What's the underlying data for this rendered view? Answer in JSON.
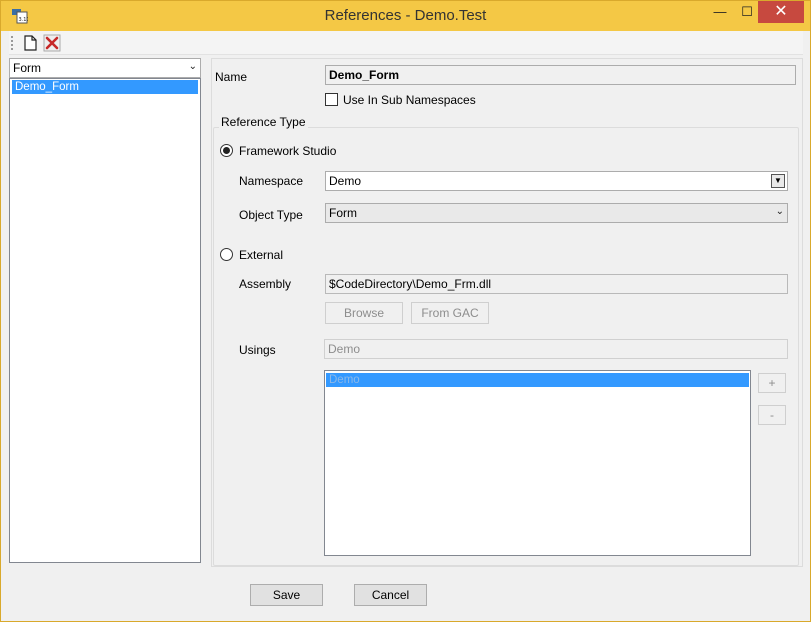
{
  "window": {
    "title": "References - Demo.Test",
    "icon": "references-app-icon",
    "minimize_glyph": "—",
    "maximize_glyph": "☐",
    "close_glyph": "✕"
  },
  "toolbar": {
    "new_icon": "new-document-icon",
    "delete_icon": "delete-x-icon"
  },
  "left": {
    "filter_value": "Form",
    "items": [
      {
        "label": "Demo_Form",
        "selected": true
      }
    ]
  },
  "form": {
    "name_label": "Name",
    "name_value": "Demo_Form",
    "sub_ns_label": "Use In Sub Namespaces",
    "sub_ns_checked": false,
    "group_title": "Reference Type",
    "framework_label": "Framework Studio",
    "framework_selected": true,
    "namespace_label": "Namespace",
    "namespace_value": "Demo",
    "object_type_label": "Object Type",
    "object_type_value": "Form",
    "external_label": "External",
    "external_selected": false,
    "assembly_label": "Assembly",
    "assembly_value": "$CodeDirectory\\Demo_Frm.dll",
    "browse_label": "Browse",
    "from_gac_label": "From GAC",
    "usings_label": "Usings",
    "usings_value": "Demo",
    "usings_items": [
      {
        "label": "Demo",
        "selected": true
      }
    ],
    "add_label": "+",
    "remove_label": "-"
  },
  "footer": {
    "save_label": "Save",
    "cancel_label": "Cancel"
  },
  "colors": {
    "titlebar": "#f4c845",
    "close_button": "#c7493f",
    "selection": "#3399ff"
  }
}
